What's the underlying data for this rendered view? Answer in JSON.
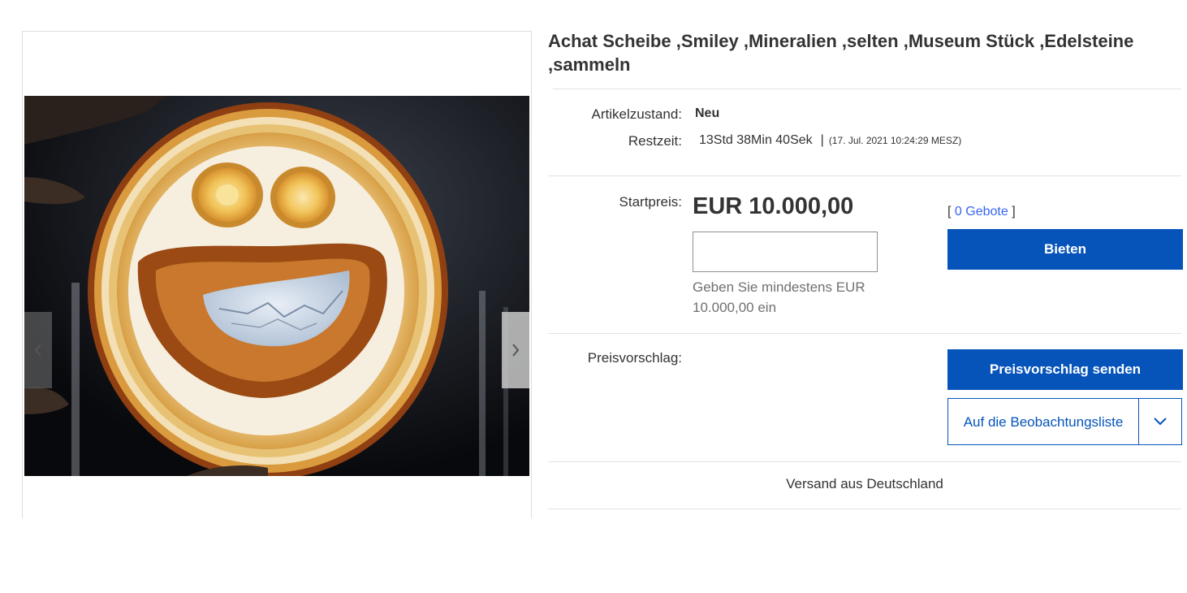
{
  "item": {
    "title": "Achat Scheibe ,Smiley ,Mineralien ,selten ,Museum Stück ,Edelsteine ,sammeln"
  },
  "gallery": {
    "image_subject": "agate-slice-smiley-photo",
    "prev_icon": "chevron-left-icon",
    "next_icon": "chevron-right-icon"
  },
  "condition": {
    "label": "Artikelzustand:",
    "value": "Neu"
  },
  "time_left": {
    "label": "Restzeit:",
    "value": "13Std 38Min 40Sek",
    "separator": "|",
    "end_time": "(17. Jul. 2021   10:24:29 MESZ)"
  },
  "price": {
    "label": "Startpreis:",
    "value": "EUR 10.000,00",
    "bid_input_value": "",
    "hint": "Geben Sie mindestens EUR 10.000,00 ein"
  },
  "bids": {
    "open": "[",
    "link": "0 Gebote",
    "close": "]"
  },
  "buttons": {
    "bid": "Bieten",
    "offer": "Preisvorschlag senden",
    "watch": "Auf die Beobachtungsliste",
    "watch_toggle_icon": "chevron-down-icon"
  },
  "offer": {
    "label": "Preisvorschlag:"
  },
  "shipping": {
    "text": "Versand aus Deutschland"
  },
  "colors": {
    "primary_button": "#0654ba",
    "link": "#3665f3",
    "hint_text": "#707070",
    "divider": "#e2e2e2"
  }
}
